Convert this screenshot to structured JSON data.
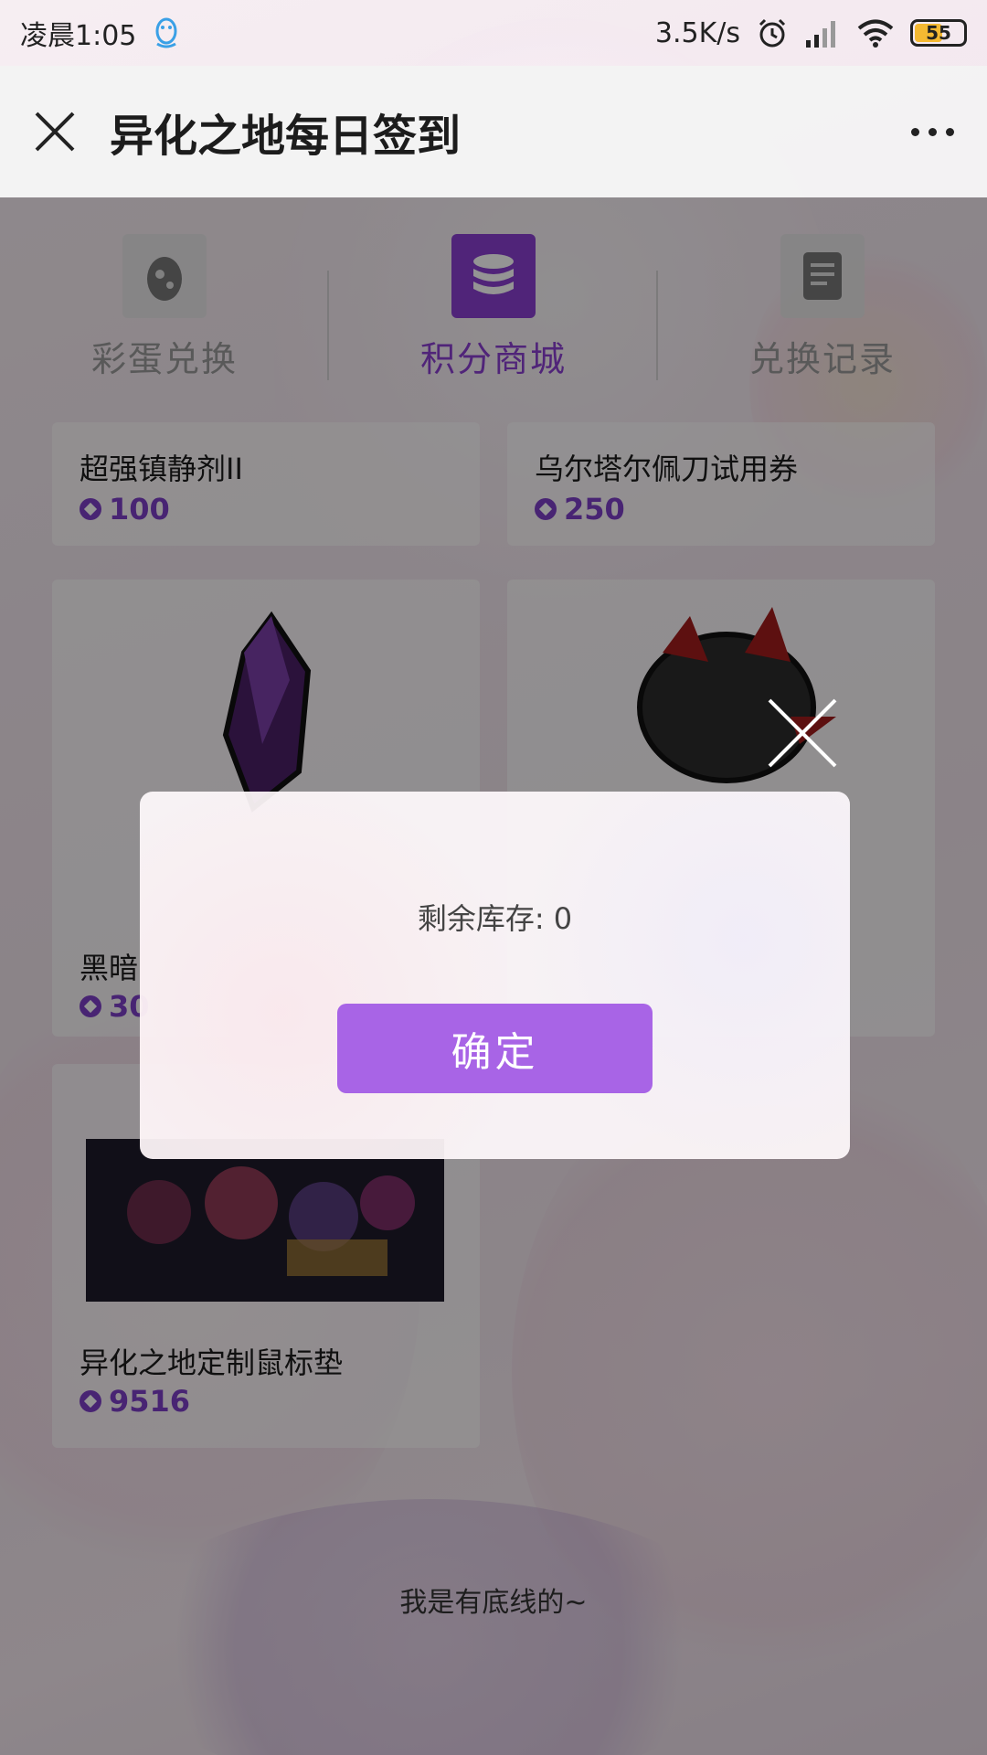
{
  "status_bar": {
    "time": "凌晨1:05",
    "network_speed": "3.5K/s",
    "battery_level": "55",
    "battery_percent": 55,
    "icons": [
      "qq-icon",
      "alarm-icon",
      "signal-icon",
      "wifi-icon",
      "battery-icon"
    ]
  },
  "header": {
    "title": "异化之地每日签到",
    "close_icon": "close-icon",
    "more_icon": "more-dots-icon"
  },
  "tabs": [
    {
      "label": "彩蛋兑换",
      "icon": "egg-icon",
      "active": false
    },
    {
      "label": "积分商城",
      "icon": "database-coins-icon",
      "active": true
    },
    {
      "label": "兑换记录",
      "icon": "record-list-icon",
      "active": false
    }
  ],
  "items": [
    {
      "name": "超强镇静剂II",
      "price": "100"
    },
    {
      "name": "乌尔塔尔佩刀试用券",
      "price": "250"
    },
    {
      "name": "黑暗",
      "price": "30"
    },
    {
      "name": "异化之地定制鼠标垫",
      "price": "9516"
    }
  ],
  "footer": {
    "text": "我是有底线的~"
  },
  "modal": {
    "message": "剩余库存: 0",
    "confirm_label": "确定"
  },
  "colors": {
    "accent": "#8b3fd1",
    "button": "#a864e6",
    "overlay": "rgba(0,0,0,0.42)"
  }
}
